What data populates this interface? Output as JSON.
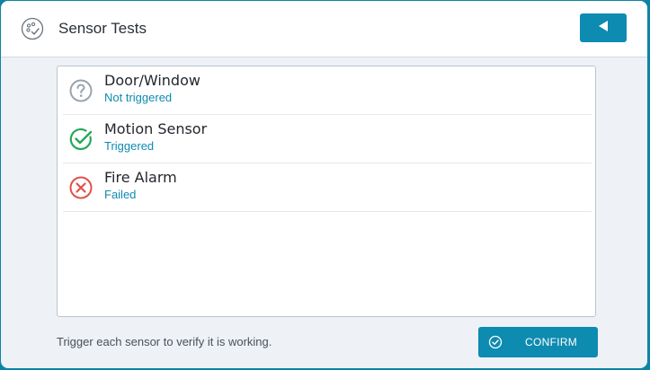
{
  "header": {
    "title": "Sensor Tests",
    "icon": "sensor-test-icon",
    "back_icon": "back-arrow-icon"
  },
  "sensors": [
    {
      "name": "Door/Window",
      "status": "Not triggered",
      "state_icon": "question-icon",
      "state_color": "#9aa4ae"
    },
    {
      "name": "Motion Sensor",
      "status": "Triggered",
      "state_icon": "check-circle-icon",
      "state_color": "#27a85a"
    },
    {
      "name": "Fire Alarm",
      "status": "Failed",
      "state_icon": "error-circle-icon",
      "state_color": "#e2504a"
    }
  ],
  "footer": {
    "hint": "Trigger each sensor to verify it is working.",
    "confirm_label": "CONFIRM",
    "confirm_icon": "check-circle-icon"
  },
  "colors": {
    "accent": "#0e8bb0",
    "border": "#0d84a4",
    "success": "#27a85a",
    "error": "#e2504a",
    "neutral": "#9aa4ae"
  }
}
